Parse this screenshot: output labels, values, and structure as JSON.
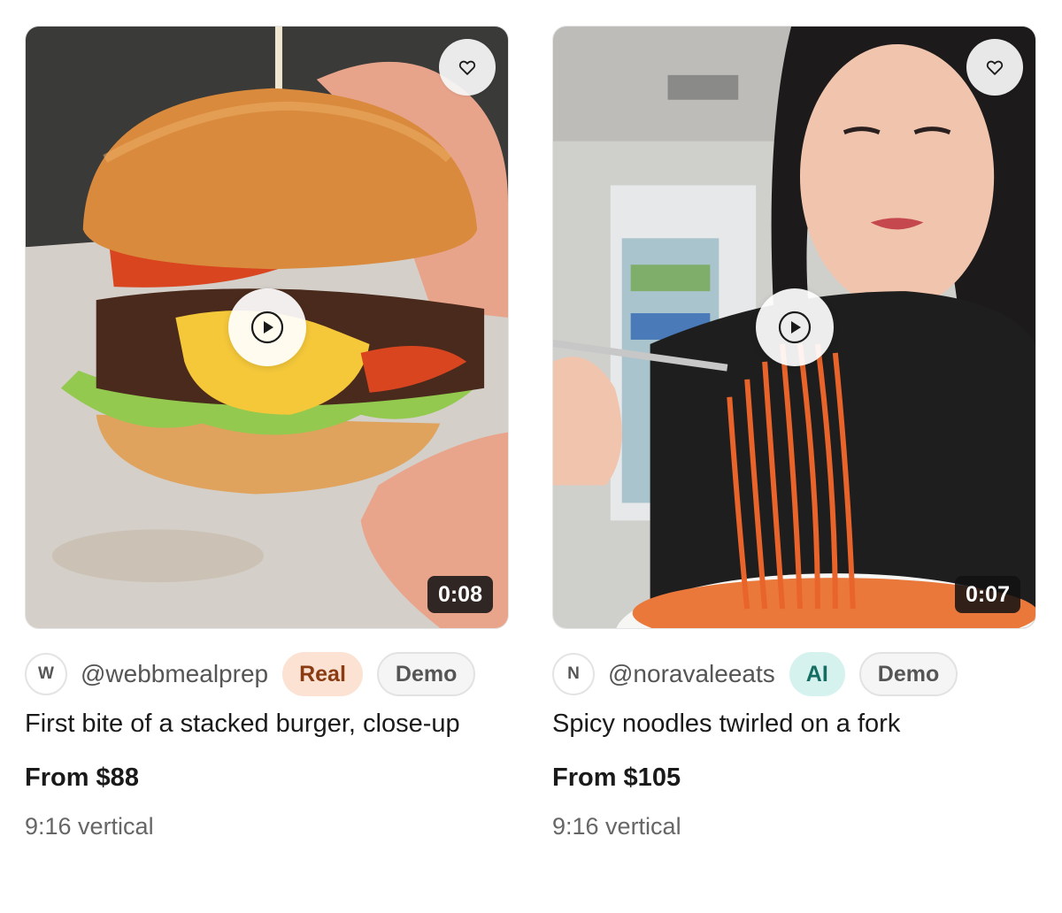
{
  "cards": [
    {
      "duration": "0:08",
      "avatar_letter": "W",
      "handle": "@webbmealprep",
      "tags": [
        "Real",
        "Demo"
      ],
      "title": "First bite of a stacked burger, close-up",
      "price": "From $88",
      "format": "9:16 vertical",
      "icons": {
        "favorite": "heart-icon",
        "play": "play-icon"
      }
    },
    {
      "duration": "0:07",
      "avatar_letter": "N",
      "handle": "@noravaleeats",
      "tags": [
        "AI",
        "Demo"
      ],
      "title": "Spicy noodles twirled on a fork",
      "price": "From $105",
      "format": "9:16 vertical",
      "icons": {
        "favorite": "heart-icon",
        "play": "play-icon"
      }
    }
  ],
  "colors": {
    "real_tag_bg": "#fbe2d3",
    "real_tag_text": "#8a3b12",
    "ai_tag_bg": "#d6f2ef",
    "ai_tag_text": "#156e62",
    "duration_badge_bg": "#111111"
  }
}
